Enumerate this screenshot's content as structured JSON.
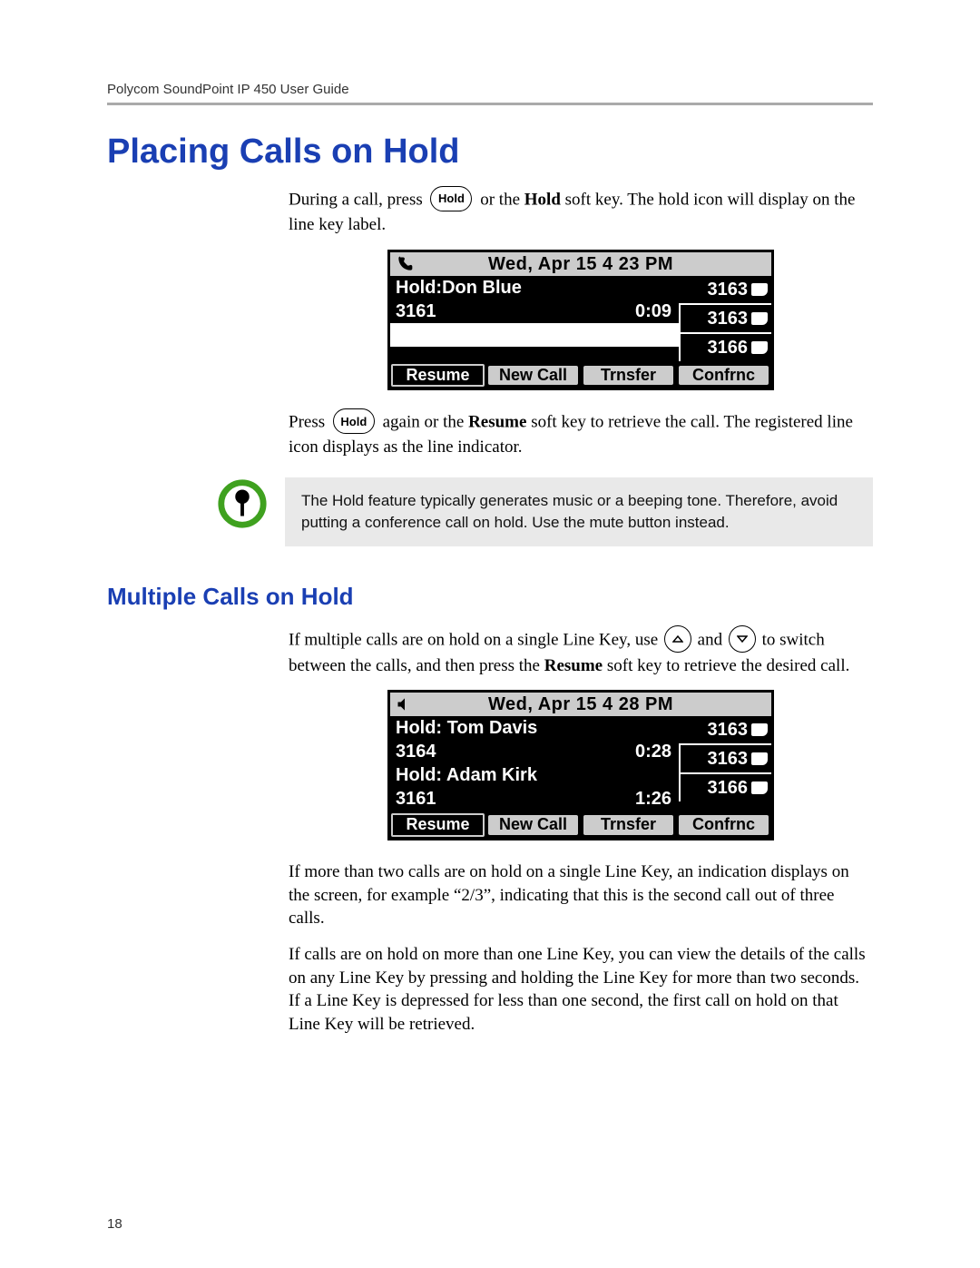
{
  "doc_header": "Polycom SoundPoint IP 450 User Guide",
  "page_number": "18",
  "section": {
    "title": "Placing Calls on Hold",
    "p1_a": "During a call, press ",
    "p1_b": " or the ",
    "p1_bold": "Hold",
    "p1_c": " soft key. The hold icon will display on the line key label.",
    "p2_a": "Press ",
    "p2_b": " again or the ",
    "p2_bold": "Resume",
    "p2_c": " soft key to retrieve the call. The registered line icon displays as the line indicator."
  },
  "hold_key_label": "Hold",
  "screen1": {
    "datetime": "Wed, Apr 15   4 23 PM",
    "rows": [
      {
        "left": "Hold:Don Blue",
        "right": ""
      },
      {
        "left": "3161",
        "right": "0:09"
      }
    ],
    "line_keys": [
      "3163",
      "3163",
      "3166"
    ],
    "softkeys": [
      "Resume",
      "New Call",
      "Trnsfer",
      "Confrnc"
    ]
  },
  "callout": {
    "text": "The Hold feature typically generates music or a beeping tone. Therefore, avoid putting a conference call on hold. Use the mute button instead."
  },
  "subsection": {
    "title": "Multiple Calls on Hold",
    "p1_a": "If multiple calls are on hold on a single Line Key, use ",
    "p1_mid": " and ",
    "p1_b": " to switch between the calls, and then press the ",
    "p1_bold": "Resume",
    "p1_c": " soft key to retrieve the desired call.",
    "p2": "If more than two calls are on hold on a single Line Key, an indication displays on the screen, for example “2/3”, indicating that this is the second call out of three calls.",
    "p3": "If calls are on hold on more than one Line Key, you can view the details of the calls on any Line Key by pressing and holding the Line Key for more than two seconds. If a Line Key is depressed for less than one second, the first call on hold on that Line Key will be retrieved."
  },
  "screen2": {
    "datetime": "Wed, Apr 15   4 28 PM",
    "rows": [
      {
        "left": "Hold: Tom Davis",
        "right": ""
      },
      {
        "left": "3164",
        "right": "0:28"
      },
      {
        "left": "Hold: Adam Kirk",
        "right": ""
      },
      {
        "left": "3161",
        "right": "1:26"
      }
    ],
    "line_keys": [
      "3163",
      "3163",
      "3166"
    ],
    "softkeys": [
      "Resume",
      "New Call",
      "Trnsfer",
      "Confrnc"
    ]
  }
}
